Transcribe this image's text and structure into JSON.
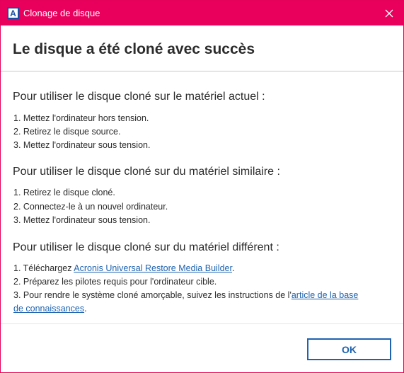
{
  "window": {
    "title": "Clonage de disque",
    "app_icon_letter": "A",
    "accent": "#e8005c"
  },
  "header": {
    "title": "Le disque a été cloné avec succès"
  },
  "sections": [
    {
      "heading": "Pour utiliser le disque cloné sur le matériel actuel :",
      "steps": [
        "1. Mettez l'ordinateur hors tension.",
        "2. Retirez le disque source.",
        "3. Mettez l'ordinateur sous tension."
      ]
    },
    {
      "heading": "Pour utiliser le disque cloné sur du matériel similaire :",
      "steps": [
        "1. Retirez le disque cloné.",
        "2. Connectez-le à un nouvel ordinateur.",
        "3. Mettez l'ordinateur sous tension."
      ]
    },
    {
      "heading": "Pour utiliser le disque cloné sur du matériel différent :",
      "step1_prefix": "1. Téléchargez ",
      "step1_link": "Acronis Universal Restore Media Builder",
      "step1_suffix": ".",
      "step2": "2. Préparez les pilotes requis pour l'ordinateur cible.",
      "step3_prefix": "3. Pour rendre le système cloné amorçable, suivez les instructions de l'",
      "step3_link_part1": "article de la base",
      "step3_link_part2": "de connaissances",
      "step3_suffix": "."
    }
  ],
  "footer": {
    "ok_label": "OK"
  }
}
